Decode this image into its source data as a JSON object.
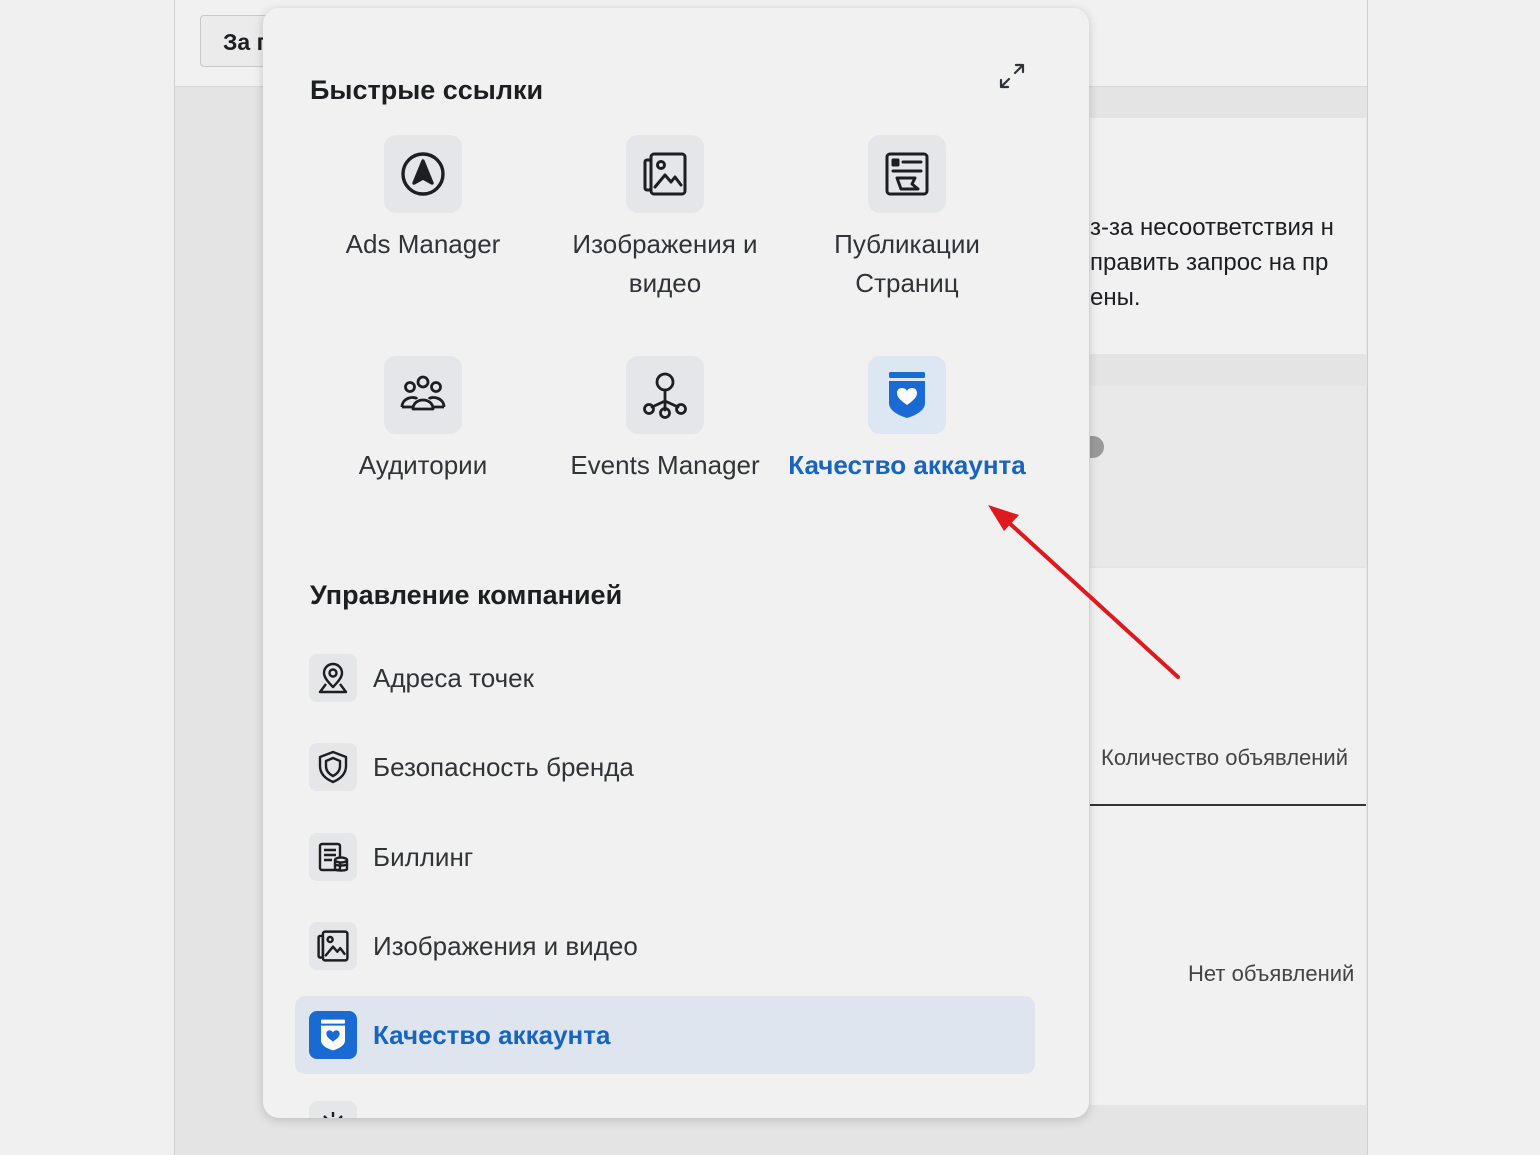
{
  "background": {
    "button_label": "За г",
    "notice_lines": [
      "з-за несоответствия н",
      "править запрос на пр",
      "ены."
    ],
    "column_header": "Количество объявлений",
    "empty_text": "Нет объявлений"
  },
  "popup": {
    "quick_links_title": "Быстрые ссылки",
    "quick_links": [
      {
        "label": "Ads Manager",
        "icon": "ads-manager-icon",
        "active": false
      },
      {
        "label": "Изображения и видео",
        "icon": "image-gallery-icon",
        "active": false
      },
      {
        "label": "Публикации Страниц",
        "icon": "page-posts-icon",
        "active": false
      },
      {
        "label": "Аудитории",
        "icon": "audience-icon",
        "active": false
      },
      {
        "label": "Events Manager",
        "icon": "events-manager-icon",
        "active": false
      },
      {
        "label": "Качество аккаунта",
        "icon": "account-quality-icon",
        "active": true
      }
    ],
    "manage_title": "Управление компанией",
    "manage_items": [
      {
        "label": "Адреса точек",
        "icon": "location-pin-icon",
        "selected": false
      },
      {
        "label": "Безопасность бренда",
        "icon": "shield-icon",
        "selected": false
      },
      {
        "label": "Биллинг",
        "icon": "billing-icon",
        "selected": false
      },
      {
        "label": "Изображения и видео",
        "icon": "image-gallery-icon",
        "selected": false
      },
      {
        "label": "Качество аккаунта",
        "icon": "account-quality-icon",
        "selected": true
      },
      {
        "label": "",
        "icon": "settings-gear-icon",
        "selected": false
      }
    ]
  },
  "colors": {
    "accent": "#1765c1",
    "arrow": "#e0191e"
  }
}
